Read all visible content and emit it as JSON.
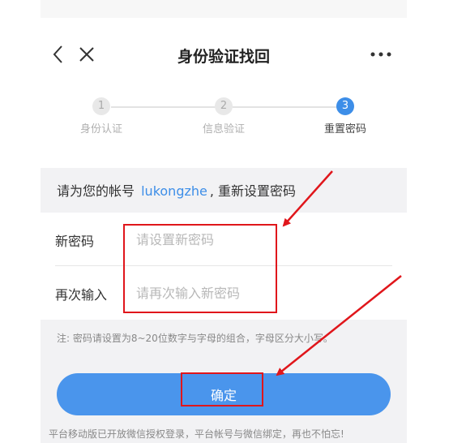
{
  "header": {
    "title": "身份验证找回"
  },
  "steps": [
    {
      "number": "1",
      "label": "身份认证",
      "state": "done"
    },
    {
      "number": "2",
      "label": "信息验证",
      "state": "done"
    },
    {
      "number": "3",
      "label": "重置密码",
      "state": "active"
    }
  ],
  "account": {
    "prefix": "请为您的帐号",
    "username": "lukongzhe",
    "suffix": ", 重新设置密码"
  },
  "form": {
    "new_password_label": "新密码",
    "new_password_placeholder": "请设置新密码",
    "confirm_password_label": "再次输入",
    "confirm_password_placeholder": "请再次输入新密码"
  },
  "note": "注: 密码请设置为8~20位数字与字母的组合，字母区分大小写。",
  "confirm_button": "确定",
  "footer_note": "平台移动版已开放微信授权登录，平台帐号与微信绑定，再也不怕忘!",
  "colors": {
    "accent": "#3d8ee8",
    "button": "#4a95ec",
    "annotation": "#e0161b"
  }
}
